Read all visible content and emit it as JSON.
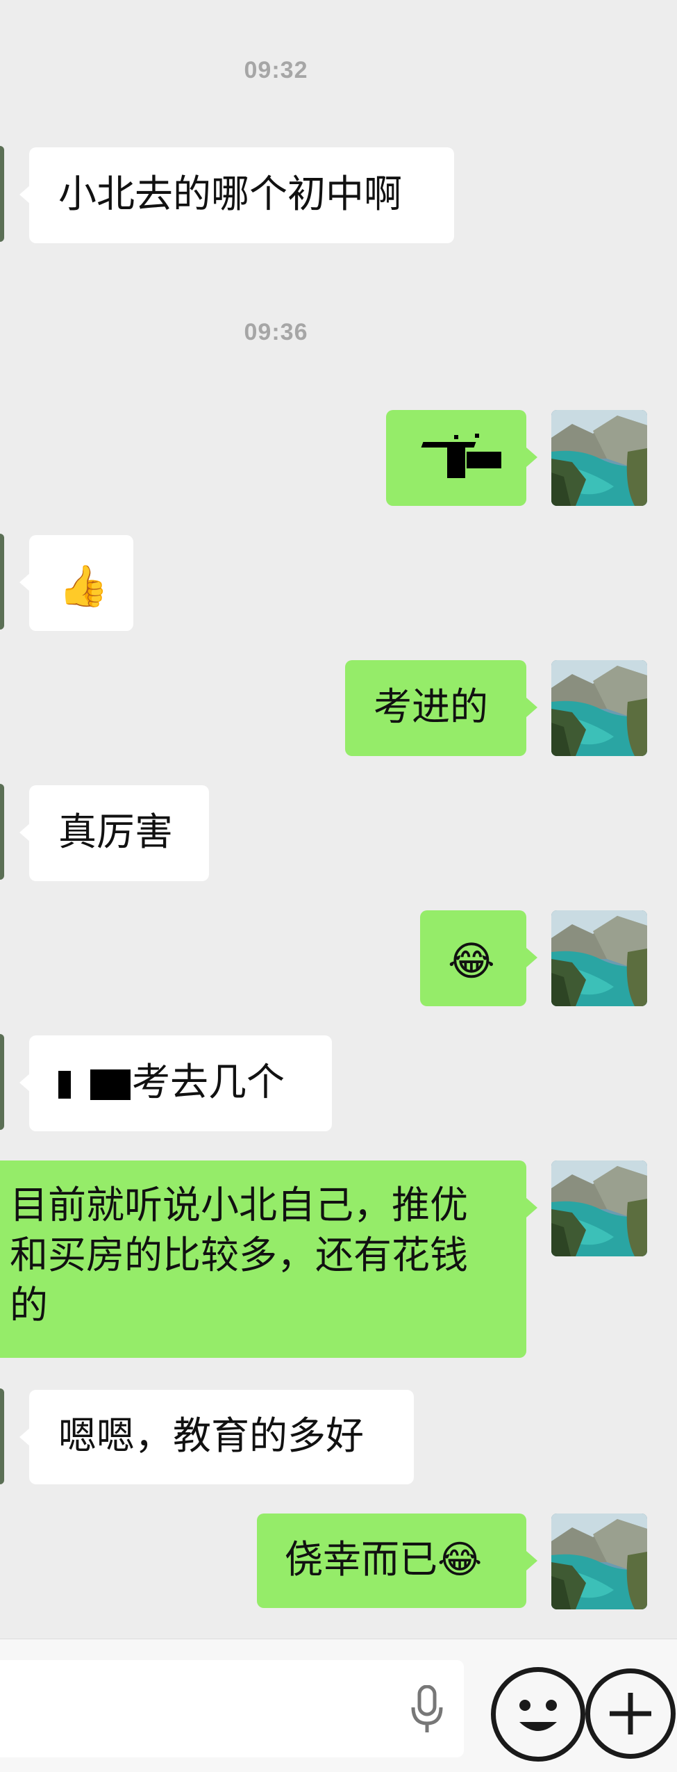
{
  "timestamps": [
    "09:32",
    "09:36"
  ],
  "messages": [
    {
      "side": "in",
      "text": "小北去的哪个初中啊"
    },
    {
      "side": "out",
      "text": "",
      "note": "redacted"
    },
    {
      "side": "in",
      "text": "👍"
    },
    {
      "side": "out",
      "text": "考进的"
    },
    {
      "side": "in",
      "text": "真厉害"
    },
    {
      "side": "out",
      "text": "😂"
    },
    {
      "side": "in",
      "text": "考去几个",
      "prefix_redacted": true
    },
    {
      "side": "out",
      "text": "目前就听说小北自己，推优和买房的比较多，还有花钱的"
    },
    {
      "side": "in",
      "text": "嗯嗯，教育的多好"
    },
    {
      "side": "out",
      "text": "侥幸而已😂"
    }
  ],
  "input": {
    "voice_icon": "microphone-icon",
    "emoji_icon": "smiley-icon",
    "more_icon": "plus-icon"
  },
  "colors": {
    "background": "#ededed",
    "incoming_bubble": "#ffffff",
    "outgoing_bubble": "#95ec69",
    "timestamp": "#a6a6a6"
  }
}
